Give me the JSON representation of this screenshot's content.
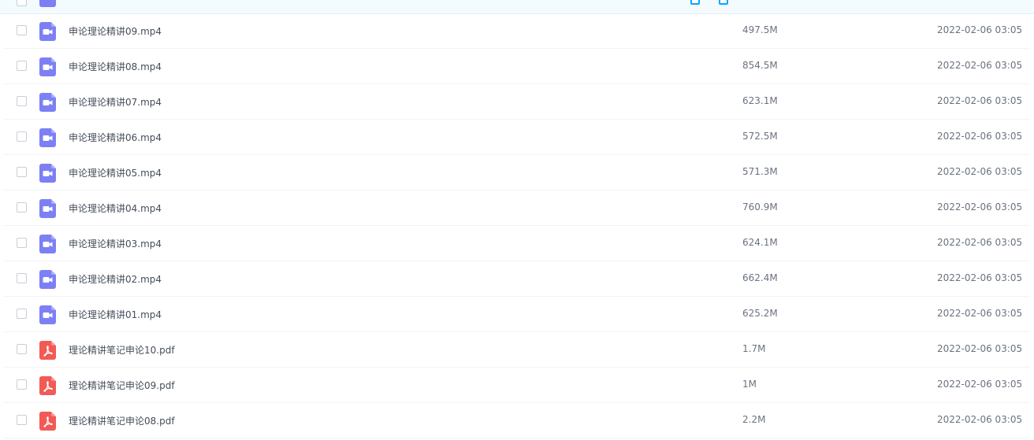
{
  "colors": {
    "video_icon": "#7c80f4",
    "pdf_icon": "#f25a55",
    "header_bg": "#f4fbff",
    "accent": "#06a7ff"
  },
  "header": {
    "action_icons": [
      "download-icon",
      "share-icon"
    ]
  },
  "files": [
    {
      "name": "申论理论精讲09.mp4",
      "size": "497.5M",
      "date": "2022-02-06 03:05",
      "type": "video"
    },
    {
      "name": "申论理论精讲08.mp4",
      "size": "854.5M",
      "date": "2022-02-06 03:05",
      "type": "video"
    },
    {
      "name": "申论理论精讲07.mp4",
      "size": "623.1M",
      "date": "2022-02-06 03:05",
      "type": "video"
    },
    {
      "name": "申论理论精讲06.mp4",
      "size": "572.5M",
      "date": "2022-02-06 03:05",
      "type": "video"
    },
    {
      "name": "申论理论精讲05.mp4",
      "size": "571.3M",
      "date": "2022-02-06 03:05",
      "type": "video"
    },
    {
      "name": "申论理论精讲04.mp4",
      "size": "760.9M",
      "date": "2022-02-06 03:05",
      "type": "video"
    },
    {
      "name": "申论理论精讲03.mp4",
      "size": "624.1M",
      "date": "2022-02-06 03:05",
      "type": "video"
    },
    {
      "name": "申论理论精讲02.mp4",
      "size": "662.4M",
      "date": "2022-02-06 03:05",
      "type": "video"
    },
    {
      "name": "申论理论精讲01.mp4",
      "size": "625.2M",
      "date": "2022-02-06 03:05",
      "type": "video"
    },
    {
      "name": "理论精讲笔记申论10.pdf",
      "size": "1.7M",
      "date": "2022-02-06 03:05",
      "type": "pdf"
    },
    {
      "name": "理论精讲笔记申论09.pdf",
      "size": "1M",
      "date": "2022-02-06 03:05",
      "type": "pdf"
    },
    {
      "name": "理论精讲笔记申论08.pdf",
      "size": "2.2M",
      "date": "2022-02-06 03:05",
      "type": "pdf"
    }
  ]
}
